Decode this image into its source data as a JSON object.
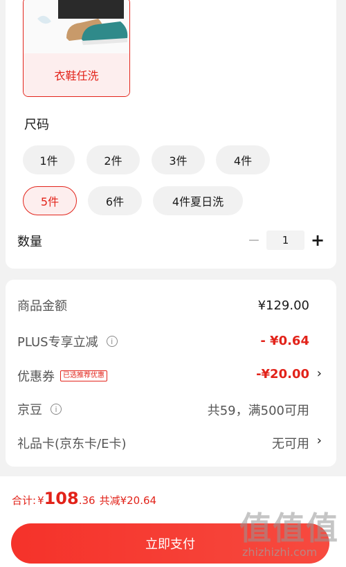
{
  "variant": {
    "label": "衣鞋任洗"
  },
  "size_section": {
    "title": "尺码"
  },
  "size_options": [
    {
      "label": "1件",
      "selected": false
    },
    {
      "label": "2件",
      "selected": false
    },
    {
      "label": "3件",
      "selected": false
    },
    {
      "label": "4件",
      "selected": false
    },
    {
      "label": "5件",
      "selected": true
    },
    {
      "label": "6件",
      "selected": false
    },
    {
      "label": "4件夏日洗",
      "selected": false
    }
  ],
  "quantity": {
    "label": "数量",
    "minus": "−",
    "value": "1",
    "plus": "+"
  },
  "price_rows": {
    "goods_amount": {
      "label": "商品金额",
      "value": "¥129.00"
    },
    "plus_discount": {
      "label": "PLUS专享立减",
      "info": "i",
      "value": "- ¥0.64"
    },
    "coupon": {
      "label": "优惠券",
      "tag": "已选推荐优惠",
      "value": "-¥20.00",
      "chevron": "›"
    },
    "jingdou": {
      "label": "京豆",
      "info": "i",
      "value": "共59，满500可用"
    },
    "gift_card": {
      "label": "礼品卡(京东卡/E卡)",
      "value": "无可用",
      "chevron": "›"
    }
  },
  "total": {
    "label": "合计:",
    "currency": "¥",
    "integer": "108",
    "decimal": ".36",
    "discount": "共减¥20.64"
  },
  "pay_button": {
    "label": "立即支付"
  },
  "watermark": {
    "glyphs": "值值值",
    "text": "zhizhizhi.com"
  },
  "colors": {
    "accent": "#e2231a",
    "accent_bg": "#fdeeee",
    "page_bg": "#f2f2f2"
  }
}
